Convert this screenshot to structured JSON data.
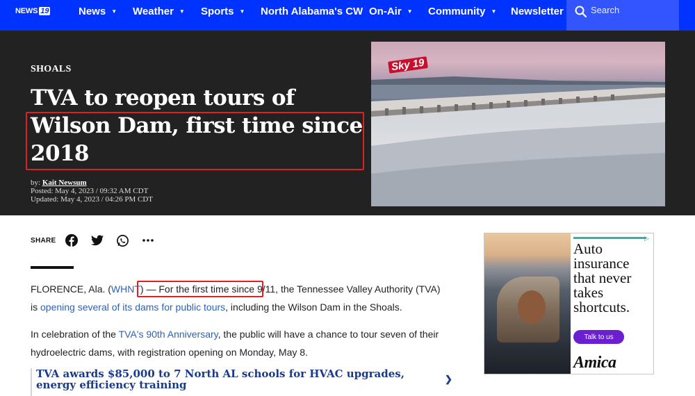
{
  "nav": {
    "logo_text": "NEWS",
    "logo_number": "19",
    "items": [
      {
        "label": "News",
        "caret": true
      },
      {
        "label": "Weather",
        "caret": true
      },
      {
        "label": "Sports",
        "caret": true
      },
      {
        "label": "North Alabama's CW",
        "caret": false
      },
      {
        "label": "On-Air",
        "caret": true
      },
      {
        "label": "Community",
        "caret": true
      },
      {
        "label": "Newsletter",
        "caret": false
      }
    ],
    "search_placeholder": "Search",
    "color": "#0033ff"
  },
  "article": {
    "section": "SHOALS",
    "headline": "TVA to reopen tours of Wilson Dam, first time since 2018",
    "byline_prefix": "by: ",
    "author": "Kait Newsum",
    "posted": "Posted: May 4, 2023 / 09:32 AM CDT",
    "updated": "Updated: May 4, 2023 / 04:26 PM CDT",
    "image_overlay": "Sky 19"
  },
  "share": {
    "label": "SHARE",
    "icons": [
      "facebook-icon",
      "twitter-icon",
      "whatsapp-icon",
      "more-icon"
    ]
  },
  "body": {
    "p1_pre": "FLORENCE, Ala. (",
    "p1_link1": "WHNT",
    "p1_mid": ") — For the first time since 9/11, the Tennessee Valley Authority (TVA) is ",
    "p1_link2": "opening several of its dams for public tours",
    "p1_post": ", including the Wilson Dam in the Shoals.",
    "p2_pre": "In celebration of the ",
    "p2_link": "TVA's 90th Anniversary",
    "p2_post": ", the public will have a chance to tour seven of their hydroelectric dams, with registration opening on Monday, May 8."
  },
  "related": {
    "title": "TVA awards $85,000 to 7 North AL schools for HVAC upgrades, energy efficiency training"
  },
  "ad": {
    "copy": "Auto insurance that never takes shortcuts.",
    "cta": "Talk to us",
    "brand": "Amica",
    "accent_color": "#2fb3a7",
    "cta_color": "#6a1fd1"
  }
}
